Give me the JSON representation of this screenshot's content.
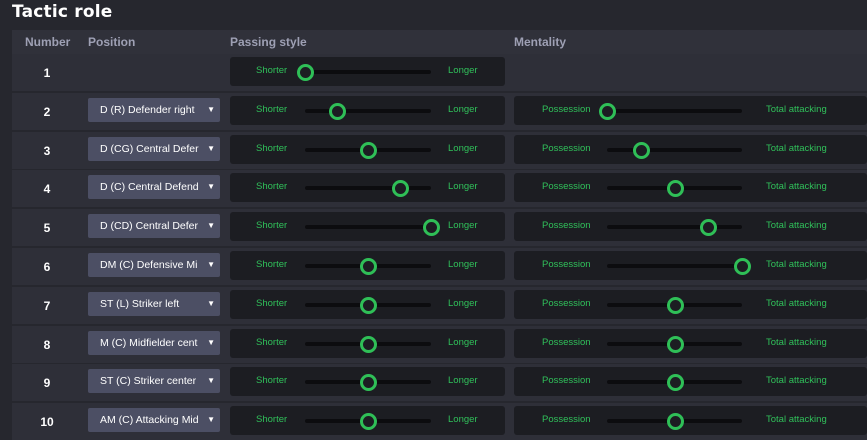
{
  "title": "Tactic role",
  "columns": {
    "number": "Number",
    "position": "Position",
    "passing": "Passing style",
    "mentality": "Mentality"
  },
  "slider_labels": {
    "passing_left": "Shorter",
    "passing_right": "Longer",
    "mentality_left": "Possession",
    "mentality_right": "Total attacking"
  },
  "colors": {
    "accent": "#2fbf57",
    "background": "#26272e",
    "row": "#2e2f38",
    "panel": "#1c1d22",
    "select": "#4c4f64"
  },
  "rows": [
    {
      "number": "1",
      "position": null,
      "passing": 0.0,
      "mentality": null
    },
    {
      "number": "2",
      "position": "D (R) Defender right",
      "passing": 0.25,
      "mentality": 0.0
    },
    {
      "number": "3",
      "position": "D (CG) Central Defer",
      "passing": 0.5,
      "mentality": 0.25
    },
    {
      "number": "4",
      "position": "D (C) Central Defend",
      "passing": 0.75,
      "mentality": 0.5
    },
    {
      "number": "5",
      "position": "D (CD) Central Defer",
      "passing": 1.0,
      "mentality": 0.75
    },
    {
      "number": "6",
      "position": "DM (C) Defensive Mi",
      "passing": 0.5,
      "mentality": 1.0
    },
    {
      "number": "7",
      "position": "ST (L) Striker left",
      "passing": 0.5,
      "mentality": 0.5
    },
    {
      "number": "8",
      "position": "M (C) Midfielder cent",
      "passing": 0.5,
      "mentality": 0.5
    },
    {
      "number": "9",
      "position": "ST (C) Striker center",
      "passing": 0.5,
      "mentality": 0.5
    },
    {
      "number": "10",
      "position": "AM (C) Attacking Mid",
      "passing": 0.5,
      "mentality": 0.5
    }
  ]
}
